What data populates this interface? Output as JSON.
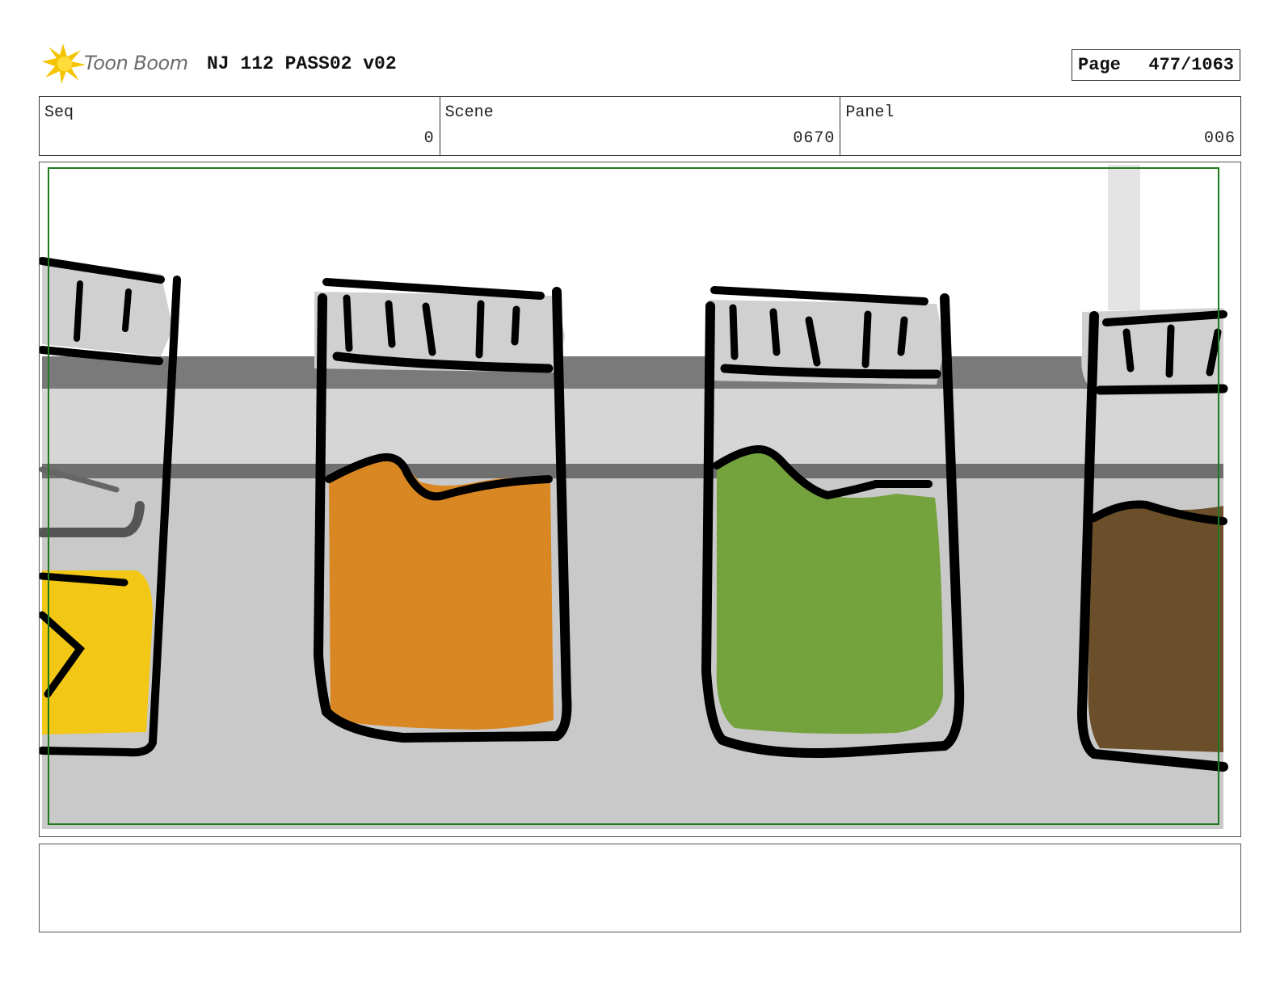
{
  "header": {
    "logo_text": "Toon Boom",
    "title": "NJ 112 PASS02 v02",
    "page_label": "Page",
    "page_value": "477/1063"
  },
  "info": {
    "seq_label": "Seq",
    "seq_value": "0",
    "scene_label": "Scene",
    "scene_value": "0670",
    "panel_label": "Panel",
    "panel_value": "006"
  },
  "panel": {
    "safe_frame_color": "#1e7a1e",
    "jars": [
      {
        "name": "yellow-jar",
        "liquid_color": "#f2c716"
      },
      {
        "name": "orange-jar",
        "liquid_color": "#d98722"
      },
      {
        "name": "green-jar",
        "liquid_color": "#74a23d"
      },
      {
        "name": "brown-jar",
        "liquid_color": "#6b4f2a"
      }
    ]
  },
  "notes": {
    "text": ""
  }
}
